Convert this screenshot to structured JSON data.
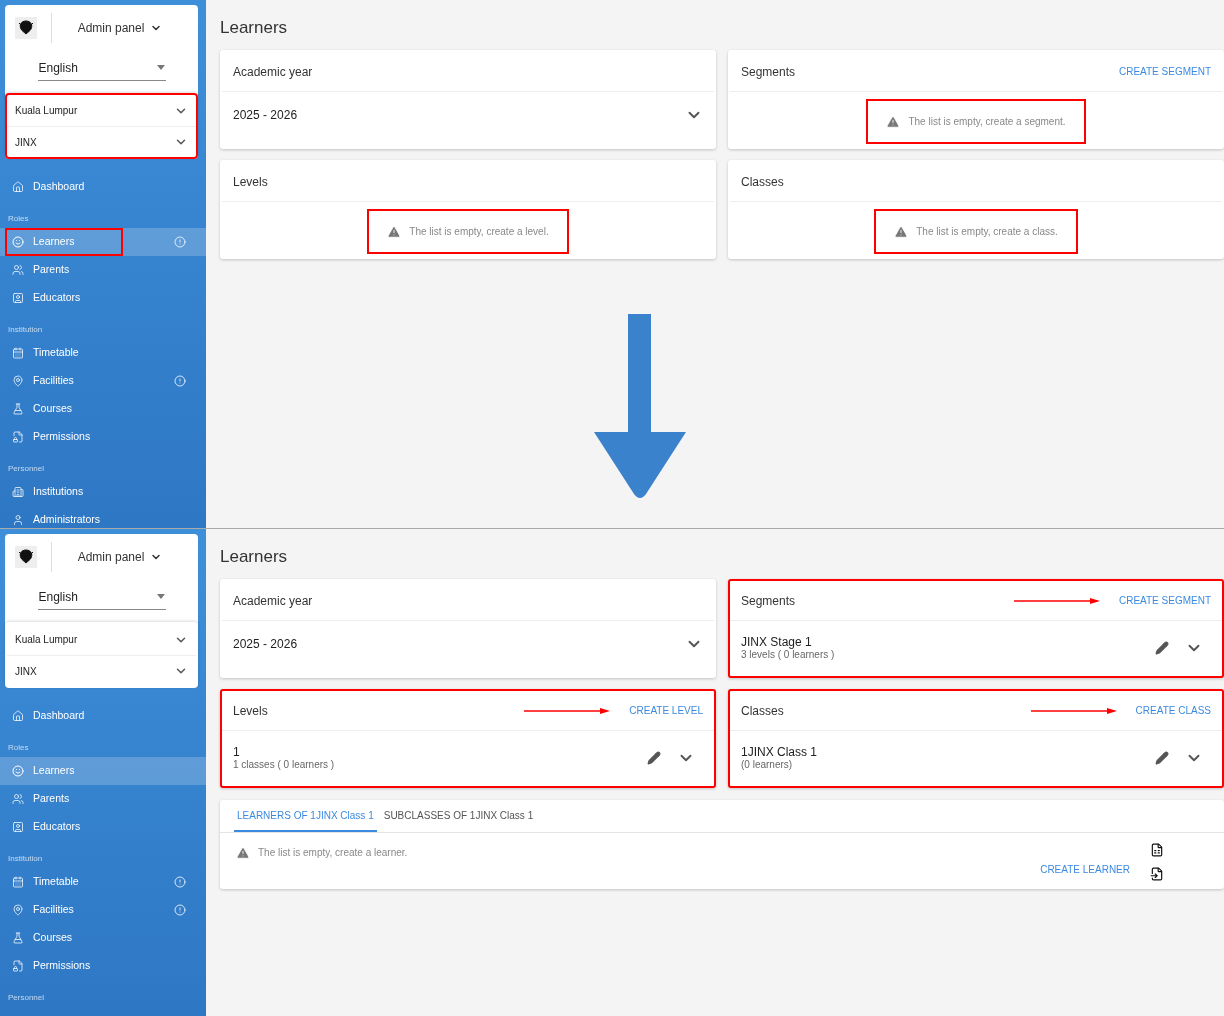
{
  "transition_arrow": true,
  "screens": [
    {
      "sidebar": {
        "panel_label": "Admin panel",
        "language": "English",
        "selects_annotated": true,
        "selects": [
          "Kuala Lumpur",
          "JINX"
        ],
        "nav": [
          {
            "kind": "link",
            "label": "Dashboard",
            "selected": false,
            "alert": false,
            "annotated": false
          },
          {
            "kind": "heading",
            "label": "Roles"
          },
          {
            "kind": "link",
            "label": "Learners",
            "selected": true,
            "alert": true,
            "annotated": true
          },
          {
            "kind": "link",
            "label": "Parents",
            "selected": false,
            "alert": false,
            "annotated": false
          },
          {
            "kind": "link",
            "label": "Educators",
            "selected": false,
            "alert": false,
            "annotated": false
          },
          {
            "kind": "heading",
            "label": "Institution"
          },
          {
            "kind": "link",
            "label": "Timetable",
            "selected": false,
            "alert": false,
            "annotated": false
          },
          {
            "kind": "link",
            "label": "Facilities",
            "selected": false,
            "alert": true,
            "annotated": false
          },
          {
            "kind": "link",
            "label": "Courses",
            "selected": false,
            "alert": false,
            "annotated": false
          },
          {
            "kind": "link",
            "label": "Permissions",
            "selected": false,
            "alert": false,
            "annotated": false
          },
          {
            "kind": "heading",
            "label": "Personnel"
          },
          {
            "kind": "link",
            "label": "Institutions",
            "selected": false,
            "alert": false,
            "annotated": false
          },
          {
            "kind": "link",
            "label": "Administrators",
            "selected": false,
            "alert": false,
            "annotated": false
          }
        ]
      },
      "main": {
        "title": "Learners",
        "cards": [
          {
            "kind": "select",
            "title": "Academic year",
            "value": "2025 - 2026"
          },
          {
            "kind": "list",
            "title": "Segments",
            "action": "CREATE SEGMENT",
            "action_arrow": false,
            "annotated": false,
            "empty": "The list is empty, create a segment.",
            "empty_annotated": true
          },
          {
            "kind": "list",
            "title": "Levels",
            "annotated": false,
            "empty": "The list is empty, create a level.",
            "empty_annotated": true
          },
          {
            "kind": "list",
            "title": "Classes",
            "annotated": false,
            "empty": "The list is empty, create a class.",
            "empty_annotated": true
          }
        ]
      }
    },
    {
      "sidebar": {
        "panel_label": "Admin panel",
        "language": "English",
        "selects_annotated": false,
        "selects": [
          "Kuala Lumpur",
          "JINX"
        ],
        "nav": [
          {
            "kind": "link",
            "label": "Dashboard",
            "selected": false,
            "alert": false,
            "annotated": false
          },
          {
            "kind": "heading",
            "label": "Roles"
          },
          {
            "kind": "link",
            "label": "Learners",
            "selected": true,
            "alert": false,
            "annotated": false
          },
          {
            "kind": "link",
            "label": "Parents",
            "selected": false,
            "alert": false,
            "annotated": false
          },
          {
            "kind": "link",
            "label": "Educators",
            "selected": false,
            "alert": false,
            "annotated": false
          },
          {
            "kind": "heading",
            "label": "Institution"
          },
          {
            "kind": "link",
            "label": "Timetable",
            "selected": false,
            "alert": true,
            "annotated": false
          },
          {
            "kind": "link",
            "label": "Facilities",
            "selected": false,
            "alert": true,
            "annotated": false
          },
          {
            "kind": "link",
            "label": "Courses",
            "selected": false,
            "alert": false,
            "annotated": false
          },
          {
            "kind": "link",
            "label": "Permissions",
            "selected": false,
            "alert": false,
            "annotated": false
          },
          {
            "kind": "heading",
            "label": "Personnel"
          }
        ]
      },
      "main": {
        "title": "Learners",
        "cards": [
          {
            "kind": "select",
            "title": "Academic year",
            "value": "2025 - 2026"
          },
          {
            "kind": "list",
            "title": "Segments",
            "action": "CREATE SEGMENT",
            "action_arrow": true,
            "annotated": true,
            "items": [
              {
                "name": "JINX Stage 1",
                "detail": "3 levels ( 0 learners )"
              }
            ]
          },
          {
            "kind": "list",
            "title": "Levels",
            "action": "CREATE LEVEL",
            "action_arrow": true,
            "annotated": true,
            "items": [
              {
                "name": "1",
                "detail": "1 classes ( 0 learners )"
              }
            ]
          },
          {
            "kind": "list",
            "title": "Classes",
            "action": "CREATE CLASS",
            "action_arrow": true,
            "annotated": true,
            "items": [
              {
                "name": "1JINX Class 1",
                "detail": "(0 learners)"
              }
            ]
          }
        ],
        "tabs_card": {
          "tabs": [
            {
              "label": "LEARNERS OF 1JINX Class 1",
              "selected": true
            },
            {
              "label": "SUBCLASSES OF 1JINX Class 1",
              "selected": false
            }
          ],
          "empty": "The list is empty, create a learner.",
          "action": "CREATE LEARNER"
        }
      }
    }
  ]
}
